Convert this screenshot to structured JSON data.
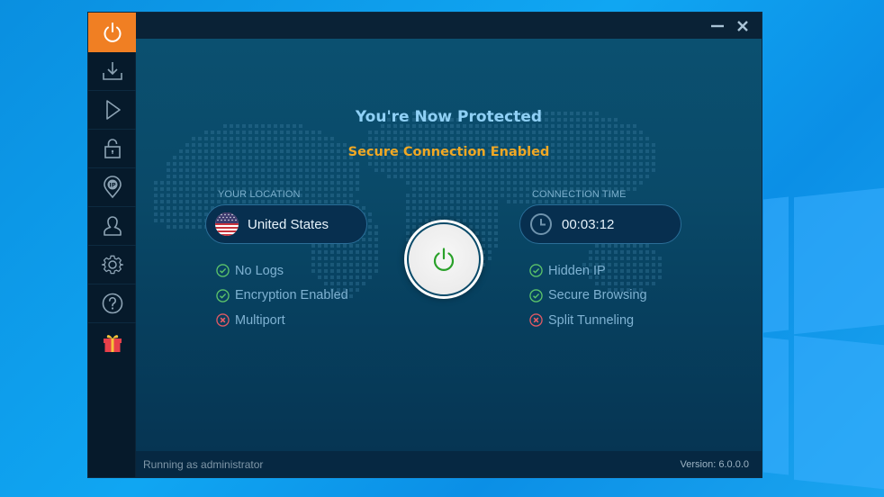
{
  "desktop": {
    "background_color": "#0f9fee"
  },
  "sidebar": {
    "items": [
      {
        "id": "connect",
        "icon": "power-icon",
        "active": true
      },
      {
        "id": "download",
        "icon": "download-icon",
        "active": false
      },
      {
        "id": "streaming",
        "icon": "play-icon",
        "active": false
      },
      {
        "id": "security",
        "icon": "lock-icon",
        "active": false
      },
      {
        "id": "ip",
        "icon": "ip-location-icon",
        "active": false
      },
      {
        "id": "account",
        "icon": "user-icon",
        "active": false
      },
      {
        "id": "settings",
        "icon": "gear-icon",
        "active": false
      },
      {
        "id": "help",
        "icon": "help-icon",
        "active": false
      },
      {
        "id": "gift",
        "icon": "gift-icon",
        "active": false
      }
    ],
    "accent_color": "#f07f23"
  },
  "window_controls": {
    "minimize_icon": "minimize-icon",
    "close_icon": "close-icon"
  },
  "main": {
    "headline": "You're Now Protected",
    "subline": "Secure Connection Enabled",
    "location": {
      "label": "YOUR LOCATION",
      "country": "United States",
      "flag_icon": "us-flag-icon"
    },
    "connection_time": {
      "label": "CONNECTION TIME",
      "value": "00:03:12",
      "icon": "clock-icon"
    },
    "power_button": {
      "state": "connected",
      "color": "#2aa12a"
    },
    "left_features": [
      {
        "label": "No Logs",
        "enabled": true
      },
      {
        "label": "Encryption Enabled",
        "enabled": true
      },
      {
        "label": "Multiport",
        "enabled": false
      }
    ],
    "right_features": [
      {
        "label": "Hidden IP",
        "enabled": true
      },
      {
        "label": "Secure Browsing",
        "enabled": true
      },
      {
        "label": "Split Tunneling",
        "enabled": false
      }
    ],
    "colors": {
      "headline": "#8fd0f5",
      "subline": "#f0a824",
      "check": "#5cc46a",
      "cross": "#e05a64"
    }
  },
  "statusbar": {
    "left_text": "Running as administrator",
    "version_text": "Version:  6.0.0.0"
  }
}
